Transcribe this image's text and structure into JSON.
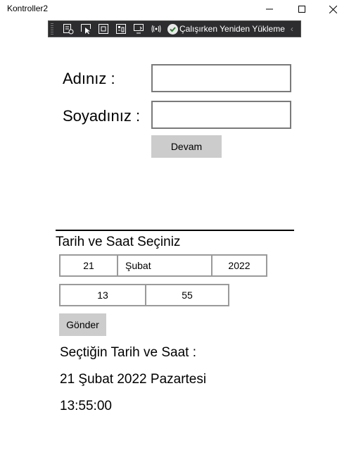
{
  "window": {
    "title": "Kontroller2",
    "minimize_icon": "minimize-icon",
    "maximize_icon": "maximize-icon",
    "close_icon": "close-icon"
  },
  "debug_toolbar": {
    "icons": [
      "live-visual-tree-icon",
      "select-element-icon",
      "display-layout-adorners-icon",
      "track-focus-icon",
      "preview-selection-icon",
      "xaml-binding-failures-icon"
    ],
    "hot_reload_label": "Çalışırken Yeniden Yükleme",
    "hot_reload_icon": "check-circle-icon",
    "collapse_icon": "chevron-left-icon"
  },
  "form": {
    "name_label": "Adınız :",
    "name_value": "",
    "surname_label": "Soyadınız :",
    "surname_value": "",
    "continue_button": "Devam"
  },
  "datetime": {
    "header": "Tarih ve Saat Seçiniz",
    "date": {
      "day": "21",
      "month": "Şubat",
      "year": "2022"
    },
    "time": {
      "hour": "13",
      "minute": "55"
    },
    "submit_button": "Gönder"
  },
  "result": {
    "caption": "Seçtiğin Tarih ve Saat :",
    "date_text": "21 Şubat 2022 Pazartesi",
    "time_text": "13:55:00"
  },
  "colors": {
    "button_bg": "#cccccc",
    "toolbar_bg": "#2d2d30",
    "border": "#7a7a7a"
  }
}
